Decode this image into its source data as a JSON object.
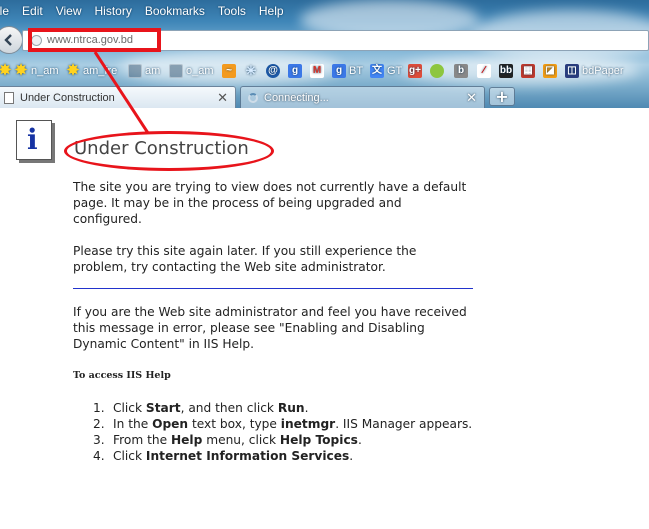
{
  "browser": {
    "menu": [
      "ile",
      "Edit",
      "View",
      "History",
      "Bookmarks",
      "Tools",
      "Help"
    ],
    "url": "www.ntrca.gov.bd",
    "bookmarks": [
      {
        "label": "n_am",
        "icon": "sun-icon"
      },
      {
        "label": "am_fre",
        "icon": "sun-icon"
      },
      {
        "label": "am",
        "icon": "square-icon"
      },
      {
        "label": "o_am",
        "icon": "square-icon"
      },
      {
        "label": "BT",
        "icon": "g-icon"
      },
      {
        "label": "GT",
        "icon": "translate-icon"
      },
      {
        "label": "bdPaper",
        "icon": "paper-icon"
      }
    ],
    "tabs": [
      {
        "title": "Under Construction",
        "active": true
      },
      {
        "title": "Connecting...",
        "active": false
      }
    ],
    "new_tab": "+"
  },
  "page": {
    "icon_glyph": "i",
    "title": "Under Construction",
    "para1": "The site you are trying to view does not currently have a default page. It may be in the process of being upgraded and configured.",
    "para2": "Please try this site again later. If you still experience the problem, try contacting the Web site administrator.",
    "para3": "If you are the Web site administrator and feel you have received this message in error, please see \"Enabling and Disabling Dynamic Content\" in IIS Help.",
    "access_heading": "To access IIS Help",
    "steps": [
      {
        "num": "1.",
        "parts": [
          "Click ",
          "Start",
          ", and then click ",
          "Run",
          "."
        ]
      },
      {
        "num": "2.",
        "parts": [
          "In the ",
          "Open",
          " text box, type ",
          "inetmgr",
          ". IIS Manager appears."
        ]
      },
      {
        "num": "3.",
        "parts": [
          "From the ",
          "Help",
          " menu, click ",
          "Help Topics",
          "."
        ]
      },
      {
        "num": "4.",
        "parts": [
          "Click ",
          "Internet Information Services",
          "."
        ]
      }
    ]
  },
  "colors": {
    "annotation": "#e8141b",
    "rule": "#2233cc",
    "info_icon": "#1633a3"
  }
}
